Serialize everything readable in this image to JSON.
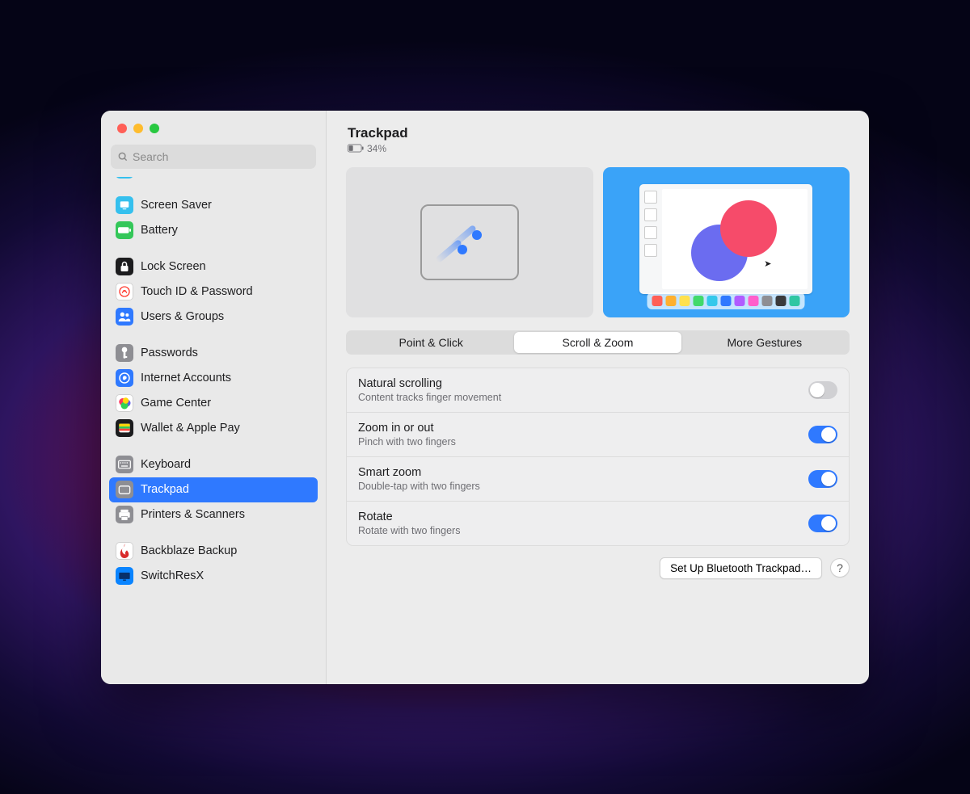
{
  "header": {
    "title": "Trackpad",
    "battery_percent": "34%"
  },
  "search": {
    "placeholder": "Search"
  },
  "sidebar": {
    "groups": [
      [
        {
          "id": "screensaver",
          "label": "Screen Saver"
        },
        {
          "id": "battery",
          "label": "Battery"
        }
      ],
      [
        {
          "id": "lockscreen",
          "label": "Lock Screen"
        },
        {
          "id": "touchid",
          "label": "Touch ID & Password"
        },
        {
          "id": "users",
          "label": "Users & Groups"
        }
      ],
      [
        {
          "id": "passwords",
          "label": "Passwords"
        },
        {
          "id": "internet",
          "label": "Internet Accounts"
        },
        {
          "id": "gamecenter",
          "label": "Game Center"
        },
        {
          "id": "wallet",
          "label": "Wallet & Apple Pay"
        }
      ],
      [
        {
          "id": "keyboard",
          "label": "Keyboard"
        },
        {
          "id": "trackpad",
          "label": "Trackpad",
          "selected": true
        },
        {
          "id": "printers",
          "label": "Printers & Scanners"
        }
      ],
      [
        {
          "id": "backblaze",
          "label": "Backblaze Backup"
        },
        {
          "id": "switchresx",
          "label": "SwitchResX"
        }
      ]
    ]
  },
  "tabs": {
    "point_click": "Point & Click",
    "scroll_zoom": "Scroll & Zoom",
    "more_gestures": "More Gestures",
    "active": "scroll_zoom"
  },
  "settings": {
    "natural_scrolling": {
      "title": "Natural scrolling",
      "sub": "Content tracks finger movement",
      "on": false
    },
    "zoom": {
      "title": "Zoom in or out",
      "sub": "Pinch with two fingers",
      "on": true
    },
    "smart_zoom": {
      "title": "Smart zoom",
      "sub": "Double-tap with two fingers",
      "on": true
    },
    "rotate": {
      "title": "Rotate",
      "sub": "Rotate with two fingers",
      "on": true
    }
  },
  "footer": {
    "bluetooth_button": "Set Up Bluetooth Trackpad…",
    "help": "?"
  },
  "dock_colors": [
    "#ff5f57",
    "#ffb02e",
    "#ffe14d",
    "#41d96b",
    "#34c8eb",
    "#2f79ff",
    "#b05cff",
    "#ff5ecb",
    "#8e8e93",
    "#3a3a3c",
    "#2fc6a3"
  ]
}
